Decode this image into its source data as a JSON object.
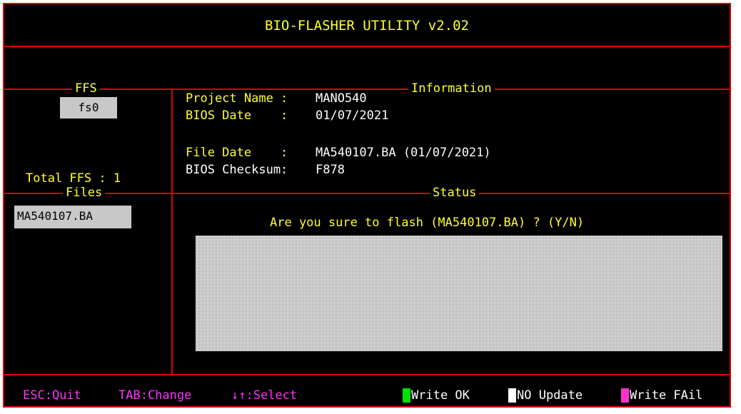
{
  "title": "BIO-FLASHER UTILITY v2.02",
  "ffs": {
    "header": "FFS",
    "selected": "fs0",
    "total_label": "Total FFS : 1"
  },
  "files": {
    "header": "Files",
    "items": [
      "MA540107.BA"
    ]
  },
  "information": {
    "header": "Information",
    "rows": [
      {
        "label": "Project Name :",
        "value": "MANO540"
      },
      {
        "label": "BIOS Date    :",
        "value": "01/07/2021"
      },
      {
        "label": "File Date    :",
        "value": "MA540107.BA (01/07/2021)"
      },
      {
        "label": "BIOS Checksum:",
        "value": "F878"
      }
    ]
  },
  "status": {
    "header": "Status",
    "prompt": "Are you sure to flash (MA540107.BA) ? (Y/N)",
    "progress": 0
  },
  "footer": {
    "keys": [
      "ESC:Quit",
      "TAB:Change",
      "↓↑:Select"
    ],
    "legend": [
      {
        "label": "Write OK",
        "color": "#00e000"
      },
      {
        "label": "NO Update",
        "color": "#ffffff"
      },
      {
        "label": "Write FAil",
        "color": "#ff33cc"
      }
    ]
  },
  "colors": {
    "border": "#e00000",
    "header_text": "#ffff33",
    "footer_text": "#ff33ff",
    "background": "#000000"
  }
}
